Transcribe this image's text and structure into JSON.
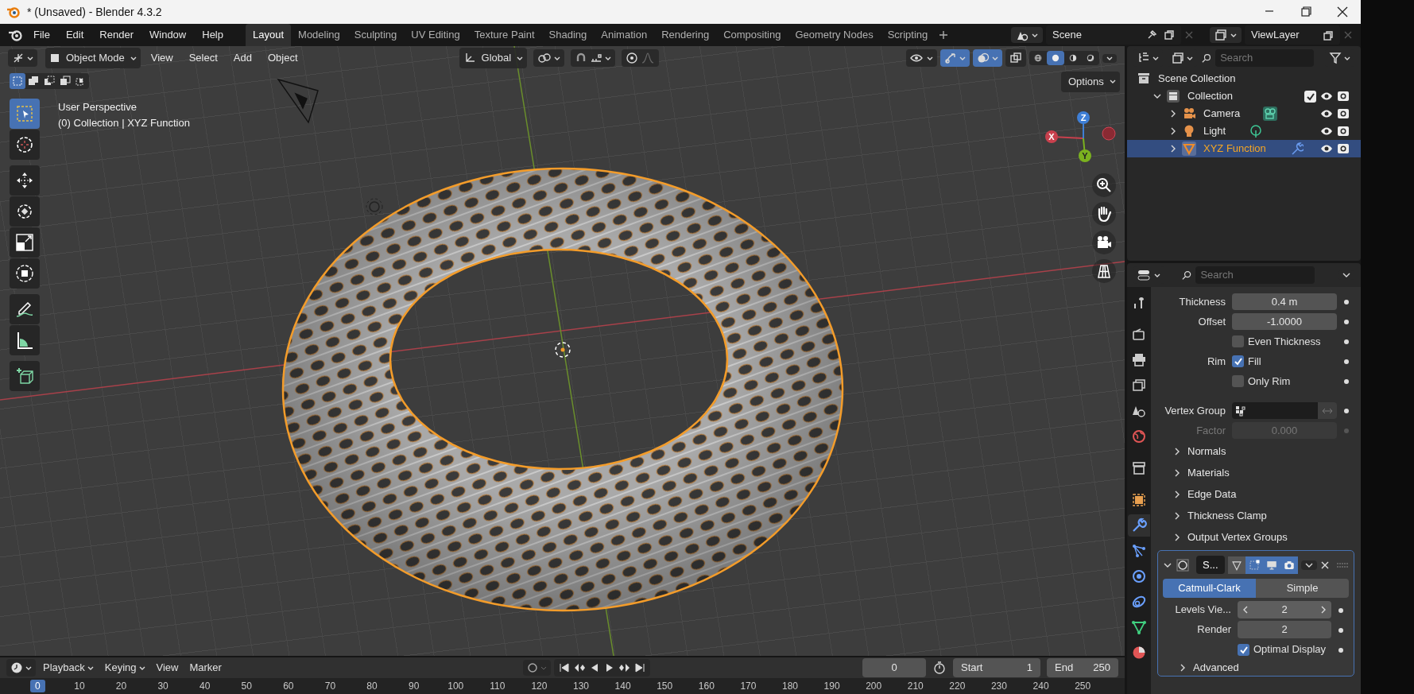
{
  "window": {
    "title": "* (Unsaved) - Blender 4.3.2"
  },
  "menu": [
    "File",
    "Edit",
    "Render",
    "Window",
    "Help"
  ],
  "workspaces": [
    {
      "label": "Layout",
      "selected": true
    },
    {
      "label": "Modeling",
      "selected": false
    },
    {
      "label": "Sculpting",
      "selected": false
    },
    {
      "label": "UV Editing",
      "selected": false
    },
    {
      "label": "Texture Paint",
      "selected": false
    },
    {
      "label": "Shading",
      "selected": false
    },
    {
      "label": "Animation",
      "selected": false
    },
    {
      "label": "Rendering",
      "selected": false
    },
    {
      "label": "Compositing",
      "selected": false
    },
    {
      "label": "Geometry Nodes",
      "selected": false
    },
    {
      "label": "Scripting",
      "selected": false
    }
  ],
  "scene": "Scene",
  "view_layer": "ViewLayer",
  "viewport": {
    "mode": "Object Mode",
    "menus": [
      "View",
      "Select",
      "Add",
      "Object"
    ],
    "orientation": "Global",
    "toggles": [
      {
        "kind": "gizmo",
        "on": true
      },
      {
        "kind": "overlay",
        "on": true
      },
      {
        "kind": "xray",
        "on": false
      }
    ],
    "shading": [
      {
        "kind": "wireframe",
        "selected": false
      },
      {
        "kind": "solid",
        "selected": true
      },
      {
        "kind": "material",
        "selected": false
      },
      {
        "kind": "rendered",
        "selected": false
      }
    ],
    "options": "Options",
    "select_modes": [
      {
        "kind": "new",
        "selected": true
      },
      {
        "kind": "extend",
        "selected": false
      },
      {
        "kind": "subtract",
        "selected": false
      },
      {
        "kind": "difference",
        "selected": false
      },
      {
        "kind": "intersect",
        "selected": false
      }
    ],
    "perspective": "User Perspective",
    "context": "(0) Collection | XYZ Function",
    "gizmo_axes": [
      "X",
      "Y",
      "Z"
    ]
  },
  "tools": [
    {
      "kind": "select_box",
      "selected": true
    },
    {
      "kind": "cursor",
      "selected": false
    },
    {
      "kind": "move",
      "selected": false
    },
    {
      "kind": "rotate",
      "selected": false
    },
    {
      "kind": "scale",
      "selected": false
    },
    {
      "kind": "transform",
      "selected": false
    },
    {
      "kind": "annotate",
      "selected": false
    },
    {
      "kind": "measure",
      "selected": false
    },
    {
      "kind": "add_cube",
      "selected": false
    }
  ],
  "outliner": {
    "placeholder": "Search",
    "tree": [
      {
        "label": "Scene Collection",
        "kind": "scene_collection",
        "selected": false,
        "children": [
          {
            "label": "Collection",
            "kind": "collection",
            "selected": false,
            "expanded": true,
            "checked": true,
            "children": [
              {
                "label": "Camera",
                "kind": "camera",
                "selected": false,
                "expanded": false
              },
              {
                "label": "Light",
                "kind": "light",
                "selected": false,
                "expanded": false
              },
              {
                "label": "XYZ Function",
                "kind": "mesh",
                "selected": true,
                "expanded": false
              }
            ]
          }
        ]
      }
    ]
  },
  "properties": {
    "placeholder": "Search",
    "tabs": [
      {
        "kind": "tool",
        "selected": false
      },
      {
        "kind": "render",
        "selected": false
      },
      {
        "kind": "output",
        "selected": false
      },
      {
        "kind": "view_layer",
        "selected": false
      },
      {
        "kind": "scene",
        "selected": false
      },
      {
        "kind": "world",
        "selected": false
      },
      {
        "kind": "collection",
        "selected": false
      },
      {
        "kind": "object",
        "selected": false
      },
      {
        "kind": "modifiers",
        "selected": true
      },
      {
        "kind": "particles",
        "selected": false
      },
      {
        "kind": "physics",
        "selected": false
      },
      {
        "kind": "constraints",
        "selected": false
      },
      {
        "kind": "data",
        "selected": false
      },
      {
        "kind": "material",
        "selected": false
      }
    ],
    "rows": [
      {
        "kind": "number",
        "label": "Thickness",
        "value": "0.4 m",
        "disabled": false
      },
      {
        "kind": "number",
        "label": "Offset",
        "value": "-1.0000",
        "disabled": false
      },
      {
        "kind": "checkbox",
        "text": "Even Thickness",
        "checked": false
      },
      {
        "kind": "checkbox",
        "label": "Rim",
        "text": "Fill",
        "checked": true
      },
      {
        "kind": "checkbox",
        "text": "Only Rim",
        "checked": false
      },
      {
        "kind": "vertex_group",
        "label": "Vertex Group"
      },
      {
        "kind": "number",
        "label": "Factor",
        "value": "0.000",
        "disabled": true
      },
      {
        "kind": "panel",
        "label": "Normals",
        "expanded": false
      },
      {
        "kind": "panel",
        "label": "Materials",
        "expanded": false
      },
      {
        "kind": "panel",
        "label": "Edge Data",
        "expanded": false
      },
      {
        "kind": "panel",
        "label": "Thickness Clamp",
        "expanded": false
      },
      {
        "kind": "panel",
        "label": "Output Vertex Groups",
        "expanded": false
      }
    ],
    "modifier": {
      "name": "S...",
      "expanded": true,
      "toggles": [
        {
          "kind": "cage",
          "on": false
        },
        {
          "kind": "edit_mode",
          "on": true
        },
        {
          "kind": "viewport",
          "on": true
        },
        {
          "kind": "render",
          "on": true
        }
      ],
      "types": [
        {
          "label": "Catmull-Clark",
          "selected": true
        },
        {
          "label": "Simple",
          "selected": false
        }
      ],
      "rows": [
        {
          "kind": "stepper",
          "label": "Levels Vie...",
          "value": "2"
        },
        {
          "kind": "number",
          "label": "Render",
          "value": "2",
          "disabled": false
        },
        {
          "kind": "checkbox",
          "text": "Optimal Display",
          "checked": true
        },
        {
          "kind": "panel",
          "label": "Advanced",
          "expanded": false
        }
      ]
    }
  },
  "timeline": {
    "menus": [
      {
        "label": "Playback",
        "dropdown": true
      },
      {
        "label": "Keying",
        "dropdown": true
      },
      {
        "label": "View",
        "dropdown": false
      },
      {
        "label": "Marker",
        "dropdown": false
      }
    ],
    "current_frame": "0",
    "start_label": "Start",
    "start": "1",
    "end_label": "End",
    "end": "250",
    "ruler": [
      {
        "label": "0",
        "selected": true
      },
      {
        "label": "10",
        "selected": false
      },
      {
        "label": "20",
        "selected": false
      },
      {
        "label": "30",
        "selected": false
      },
      {
        "label": "40",
        "selected": false
      },
      {
        "label": "50",
        "selected": false
      },
      {
        "label": "60",
        "selected": false
      },
      {
        "label": "70",
        "selected": false
      },
      {
        "label": "80",
        "selected": false
      },
      {
        "label": "90",
        "selected": false
      },
      {
        "label": "100",
        "selected": false
      },
      {
        "label": "110",
        "selected": false
      },
      {
        "label": "120",
        "selected": false
      },
      {
        "label": "130",
        "selected": false
      },
      {
        "label": "140",
        "selected": false
      },
      {
        "label": "150",
        "selected": false
      },
      {
        "label": "160",
        "selected": false
      },
      {
        "label": "170",
        "selected": false
      },
      {
        "label": "180",
        "selected": false
      },
      {
        "label": "190",
        "selected": false
      },
      {
        "label": "200",
        "selected": false
      },
      {
        "label": "210",
        "selected": false
      },
      {
        "label": "220",
        "selected": false
      },
      {
        "label": "230",
        "selected": false
      },
      {
        "label": "240",
        "selected": false
      },
      {
        "label": "250",
        "selected": false
      }
    ]
  }
}
